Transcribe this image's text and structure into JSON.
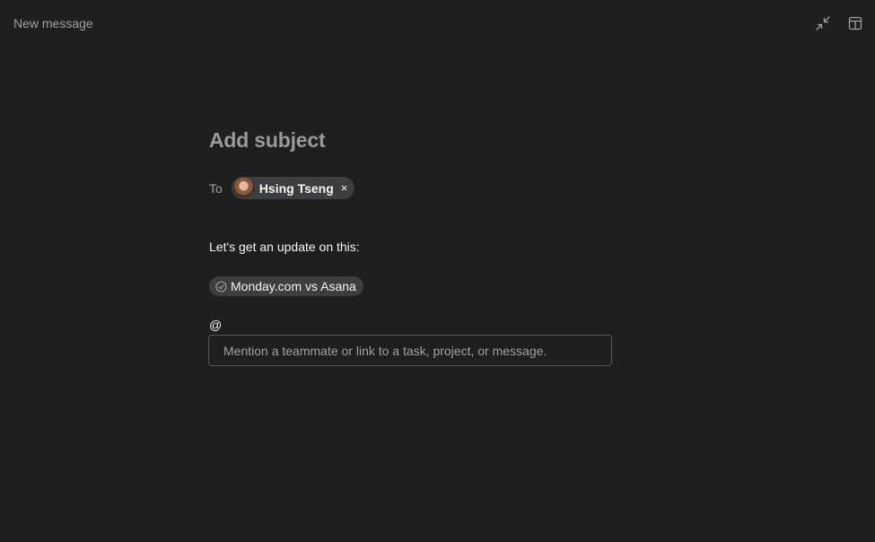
{
  "window": {
    "title": "New message",
    "controls": [
      {
        "name": "collapse-icon"
      },
      {
        "name": "layout-panel-icon"
      }
    ]
  },
  "composer": {
    "subject_placeholder": "Add subject",
    "to_label": "To",
    "recipients": [
      {
        "name": "Hsing Tseng",
        "remove_glyph": "×"
      }
    ],
    "body_text": "Let's get an update on this:",
    "linked_task": {
      "label": "Monday.com vs Asana",
      "icon": "check-circle-icon"
    },
    "mention_trigger": "@",
    "mention_placeholder": "Mention a teammate or link to a task, project, or message."
  },
  "colors": {
    "background": "#1e1f21",
    "chip": "#3d3e40",
    "muted_text": "#a2a0a2",
    "text": "#f5f4f3"
  }
}
